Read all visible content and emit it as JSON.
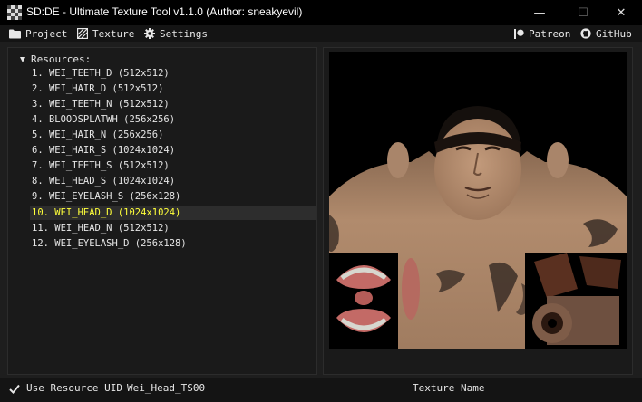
{
  "window": {
    "title": "SD:DE - Ultimate Texture Tool v1.1.0 (Author: sneakyevil)",
    "minimize_glyph": "—",
    "maximize_glyph": "☐",
    "close_glyph": "✕"
  },
  "menu": {
    "left": [
      {
        "label": "Project",
        "icon": "folder-icon"
      },
      {
        "label": "Texture",
        "icon": "texture-icon"
      },
      {
        "label": "Settings",
        "icon": "gear-icon"
      }
    ],
    "right": [
      {
        "label": "Patreon",
        "icon": "patreon-icon"
      },
      {
        "label": "GitHub",
        "icon": "github-icon"
      }
    ]
  },
  "resources": {
    "header": "Resources:",
    "items": [
      "1. WEI_TEETH_D (512x512)",
      "2. WEI_HAIR_D (512x512)",
      "3. WEI_TEETH_N (512x512)",
      "4. BLOODSPLATWH (256x256)",
      "5. WEI_HAIR_N (256x256)",
      "6. WEI_HAIR_S (1024x1024)",
      "7. WEI_TEETH_S (512x512)",
      "8. WEI_HEAD_S (1024x1024)",
      "9. WEI_EYELASH_S (256x128)",
      "10. WEI_HEAD_D (1024x1024)",
      "11. WEI_HEAD_N (512x512)",
      "12. WEI_EYELASH_D (256x128)"
    ],
    "selected_index": 9
  },
  "status": {
    "use_uid_label": "Use Resource UID",
    "use_uid_checked": true,
    "resource_uid": "Wei_Head_TS00",
    "texture_name_label": "Texture Name"
  },
  "texture": {
    "alt": "WEI_HEAD_D texture preview",
    "skin": "#b48c6e",
    "hair": "#15100d",
    "tattoo": "#3b2e27"
  }
}
